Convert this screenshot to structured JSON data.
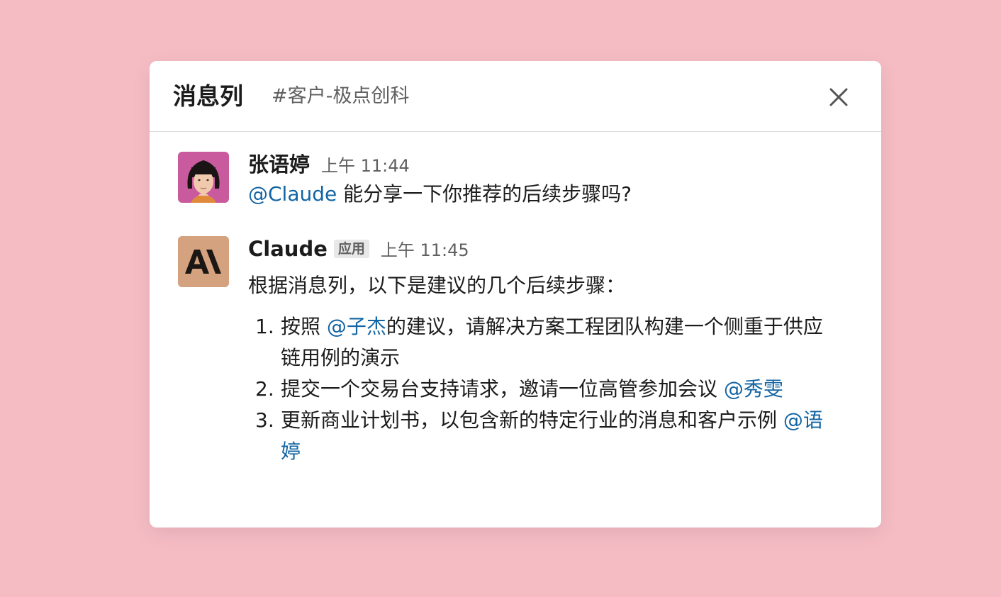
{
  "header": {
    "title": "消息列",
    "channel": "#客户-极点创科"
  },
  "messages": [
    {
      "author": "张语婷",
      "time": "上午 11:44",
      "mention": "@Claude",
      "text": " 能分享一下你推荐的后续步骤吗?"
    },
    {
      "author": "Claude",
      "badge": "应用",
      "time": "上午 11:45",
      "intro": "根据消息列，以下是建议的几个后续步骤：",
      "steps": [
        {
          "num": "1.",
          "before": "按照 ",
          "mention": "@子杰",
          "after": "的建议，请解决方案工程团队构建一个侧重于供应链用例的演示"
        },
        {
          "num": "2.",
          "before": "提交一个交易台支持请求，邀请一位高管参加会议 ",
          "mention": "@秀雯",
          "after": ""
        },
        {
          "num": "3.",
          "before": "更新商业计划书，以包含新的特定行业的消息和客户示例 ",
          "mention": "@语婷",
          "after": ""
        }
      ]
    }
  ],
  "colors": {
    "background": "#f5bcc4",
    "mention": "#1264a3",
    "claude_avatar": "#d4a27f",
    "user_avatar_bg": "#c95a9e"
  },
  "icons": {
    "close": "close-icon",
    "claude_logo": "anthropic-logo-icon"
  }
}
